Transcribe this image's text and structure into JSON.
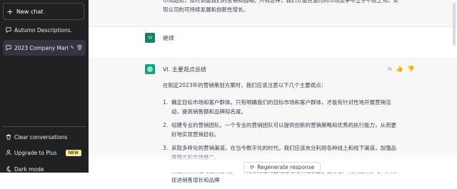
{
  "sidebar": {
    "new_chat": "New chat",
    "conversations": [
      {
        "label": "Autumn Descriptions."
      },
      {
        "label": "2023 Company Marketi"
      }
    ],
    "bottom": {
      "clear": "Clear conversations",
      "upgrade": "Upgrade to Plus",
      "upgrade_badge": "NEW",
      "dark_mode": "Dark mode"
    }
  },
  "chat": {
    "prev_text": "市场趋势，及时调整我们的营销和战略。只有这样，我们才能在激烈的市场竞争中立于不败之地，实现公司的可持续发展和创新性增长。",
    "user_avatar": "YI",
    "user_message": "继续",
    "assistant_heading": "VI. 主要观点总结",
    "intro": "在制定2023年的营销策划方案时，我们应该注意以下几个主要观点：",
    "points": [
      {
        "num": "1.",
        "text": "确定目标市场和客户群体。只有明确我们的目标市场和客户群体，才能有针对性地开展营销活动，提高销售额和品牌知名度。"
      },
      {
        "num": "2.",
        "text": "组建专业的营销团队。一个专业的营销团队可以提供创新的营销策略和优秀的执行能力，从而更好地实现营销目标。"
      },
      {
        "num": "3.",
        "text": "采取多样化的营销渠道。在当今数字化的时代，我们应该充分利用各种线上和线下渠道，加强品牌曝光和市场推广。"
      },
      {
        "num": "4.",
        "text": "策划有针对性的营销活动。一个有针对性的营销活动可以吸引更多目标客户的关注和参与，从而促进销售增长和品牌"
      }
    ],
    "regenerate": "Regenerate response"
  }
}
